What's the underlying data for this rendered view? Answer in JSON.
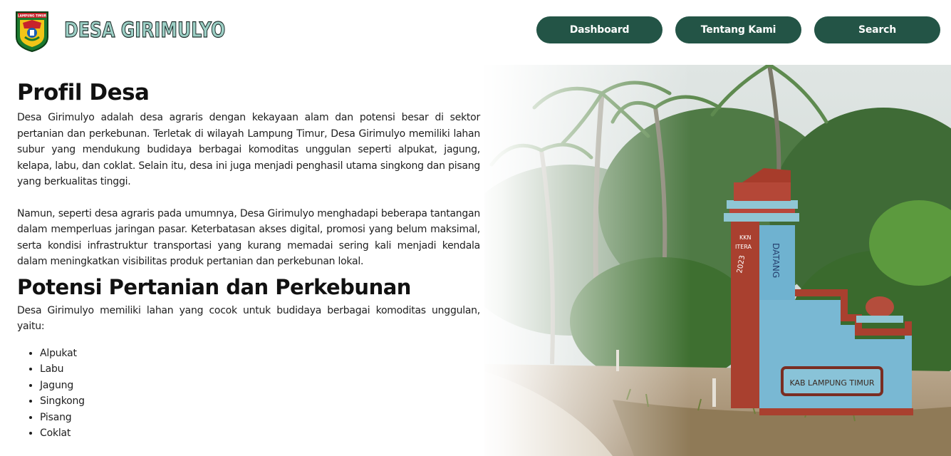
{
  "header": {
    "brand": "DESA GIRIMULYO",
    "logo_text": "LAMPUNG TIMUR",
    "nav": {
      "dashboard": "Dashboard",
      "tentang": "Tentang Kami",
      "search": "Search"
    }
  },
  "colors": {
    "nav_button": "#235446",
    "brand_fill": "#9ccfc5",
    "brand_outline": "#1f2d2b"
  },
  "content": {
    "profil_title": "Profil Desa",
    "profil_p1": "Desa Girimulyo adalah desa agraris dengan kekayaan alam dan potensi besar di sektor pertanian dan perkebunan. Terletak di wilayah Lampung Timur, Desa Girimulyo memiliki lahan subur yang mendukung budidaya berbagai komoditas unggulan seperti alpukat, jagung, kelapa, labu, dan coklat. Selain itu, desa ini juga menjadi penghasil utama singkong dan pisang yang berkualitas tinggi.",
    "profil_p2": "Namun, seperti desa agraris pada umumnya, Desa Girimulyo menghadapi beberapa tantangan dalam memperluas jaringan pasar. Keterbatasan akses digital, promosi yang belum maksimal, serta kondisi infrastruktur transportasi yang kurang memadai sering kali menjadi kendala dalam meningkatkan visibilitas produk pertanian dan perkebunan lokal.",
    "potensi_title": "Potensi Pertanian dan Perkebunan",
    "potensi_p": "Desa Girimulyo memiliki lahan yang cocok untuk budidaya berbagai komoditas unggulan, yaitu:",
    "commodities": [
      "Alpukat",
      "Labu",
      "Jagung",
      "Singkong",
      "Pisang",
      "Coklat"
    ]
  },
  "image": {
    "gate_text_1": "KKN",
    "gate_text_2": "ITERA",
    "gate_text_3": "2023",
    "gate_text_vertical": "DATANG",
    "gate_sign": "KAB LAMPUNG TIMUR"
  }
}
